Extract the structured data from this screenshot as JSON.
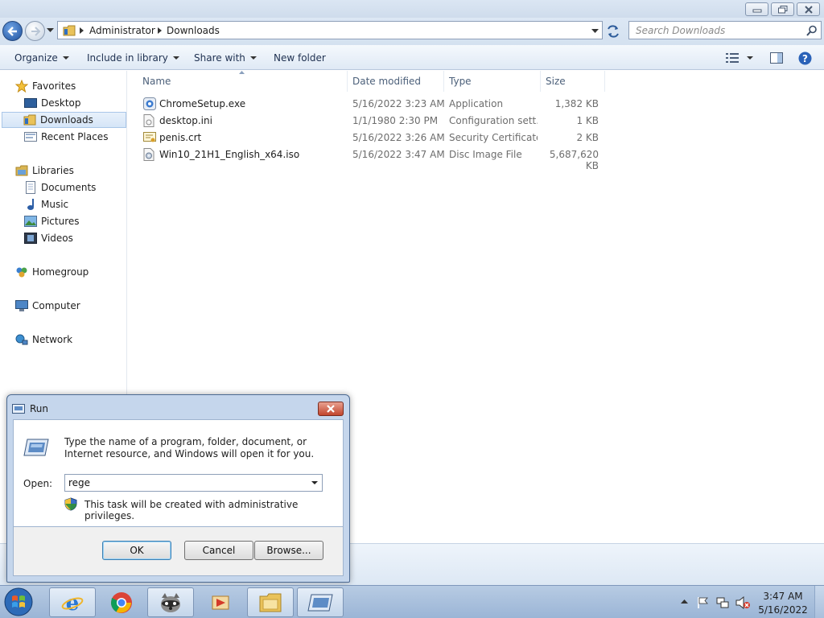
{
  "explorer": {
    "breadcrumb": [
      "Administrator",
      "Downloads"
    ],
    "search_placeholder": "Search Downloads",
    "toolbar": {
      "organize": "Organize",
      "include_in_library": "Include in library",
      "share_with": "Share with",
      "new_folder": "New folder"
    },
    "nav": {
      "favorites": "Favorites",
      "desktop": "Desktop",
      "downloads": "Downloads",
      "recent_places": "Recent Places",
      "libraries": "Libraries",
      "documents": "Documents",
      "music": "Music",
      "pictures": "Pictures",
      "videos": "Videos",
      "homegroup": "Homegroup",
      "computer": "Computer",
      "network": "Network"
    },
    "columns": {
      "name": "Name",
      "date_modified": "Date modified",
      "type": "Type",
      "size": "Size"
    },
    "files": [
      {
        "name": "ChromeSetup.exe",
        "date": "5/16/2022 3:23 AM",
        "type": "Application",
        "size": "1,382 KB",
        "icon": "application-icon"
      },
      {
        "name": "desktop.ini",
        "date": "1/1/1980 2:30 PM",
        "type": "Configuration sett...",
        "size": "1 KB",
        "icon": "settings-file-icon"
      },
      {
        "name": "penis.crt",
        "date": "5/16/2022 3:26 AM",
        "type": "Security Certificate",
        "size": "2 KB",
        "icon": "certificate-icon"
      },
      {
        "name": "Win10_21H1_English_x64.iso",
        "date": "5/16/2022 3:47 AM",
        "type": "Disc Image File",
        "size": "5,687,620 KB",
        "icon": "disc-image-icon"
      }
    ]
  },
  "run_dialog": {
    "title": "Run",
    "description": "Type the name of a program, folder, document, or Internet resource, and Windows will open it for you.",
    "open_label": "Open:",
    "open_value": "rege",
    "admin_note": "This task will be created with administrative privileges.",
    "ok": "OK",
    "cancel": "Cancel",
    "browse": "Browse..."
  },
  "taskbar": {
    "time": "3:47 AM",
    "date": "5/16/2022"
  }
}
